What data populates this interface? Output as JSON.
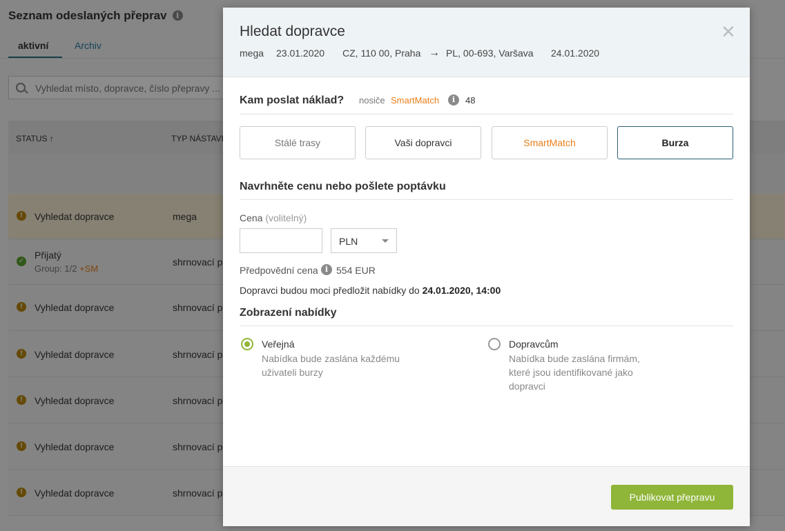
{
  "background": {
    "title": "Seznam odeslaných přeprav",
    "tabs": [
      {
        "label": "aktivní"
      },
      {
        "label": "Archiv"
      }
    ],
    "search_placeholder": "Vyhledat místo, dopravce, číslo přepravy ...",
    "columns": [
      "STATUS ↑",
      "TYP NÁSTAVB"
    ],
    "rows": [
      {
        "status": "Vyhledat dopravce",
        "type": "mega"
      },
      {
        "status": "Přijatý",
        "sub": "Group: 1/2",
        "sub_sm": "+SM",
        "type": "shrnovací p"
      },
      {
        "status": "Vyhledat dopravce",
        "type": "shrnovací p"
      },
      {
        "status": "Vyhledat dopravce",
        "type": "shrnovací p"
      },
      {
        "status": "Vyhledat dopravce",
        "type": "shrnovací p"
      },
      {
        "status": "Vyhledat dopravce",
        "type": "shrnovací p"
      },
      {
        "status": "Vyhledat dopravce",
        "type": "shrnovací p"
      }
    ]
  },
  "modal": {
    "title": "Hledat dopravce",
    "route": {
      "body": "mega",
      "date_from": "23.01.2020",
      "from": "CZ, 110 00, Praha",
      "to": "PL, 00-693, Varšava",
      "date_to": "24.01.2020"
    },
    "send_section": {
      "title": "Kam poslat náklad?",
      "carriers_label": "nosiče",
      "smartmatch_label": "SmartMatch",
      "count": "48"
    },
    "channels": [
      {
        "label": "Stálé trasy"
      },
      {
        "label": "Vaši dopravci"
      },
      {
        "label": "SmartMatch"
      },
      {
        "label": "Burza",
        "selected": true
      }
    ],
    "price_section": {
      "title": "Navrhněte cenu nebo pošlete poptávku",
      "price_label": "Cena",
      "price_optional": "(volitelný)",
      "price_value": "",
      "currency": "PLN",
      "prediction_label": "Předpovědní cena",
      "prediction_value": "554 EUR",
      "deadline_text": "Dopravci budou moci předložit nabídky do",
      "deadline_value": "24.01.2020, 14:00"
    },
    "visibility_section": {
      "title": "Zobrazení nabídky",
      "options": [
        {
          "label": "Veřejná",
          "description": "Nabídka bude zaslána každému uživateli burzy",
          "selected": true
        },
        {
          "label": "Dopravcům",
          "description": "Nabídka bude zaslána firmám, které jsou identifikované jako dopravci",
          "selected": false
        }
      ]
    },
    "publish_label": "Publikovat přepravu"
  },
  "colors": {
    "accent_green": "#8fb539",
    "smartmatch_orange": "#e87e1b",
    "selected_border": "#2a5d74"
  }
}
